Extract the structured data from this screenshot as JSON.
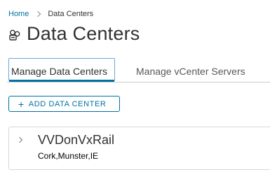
{
  "breadcrumb": {
    "home": "Home",
    "current": "Data Centers"
  },
  "page": {
    "title": "Data Centers",
    "icon": "datacenter-icon"
  },
  "tabs": [
    {
      "label": "Manage Data Centers",
      "active": true
    },
    {
      "label": "Manage vCenter Servers",
      "active": false
    }
  ],
  "toolbar": {
    "add_label": "ADD DATA CENTER",
    "add_icon": "plus-icon"
  },
  "datacenters": [
    {
      "name": "VVDonVxRail",
      "location": "Cork,Munster,IE",
      "expand_icon": "chevron-right-icon"
    }
  ],
  "colors": {
    "accent": "#0072a3",
    "text": "#313131",
    "border": "#d7d7d7"
  }
}
